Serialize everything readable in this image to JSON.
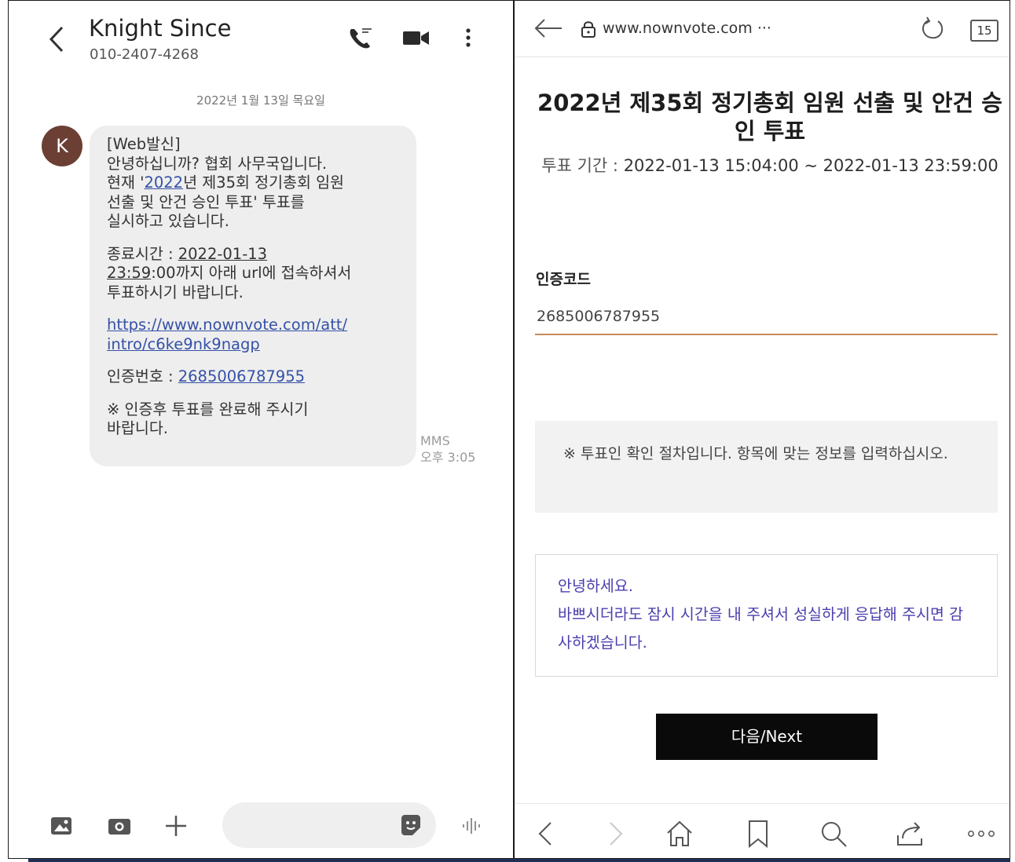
{
  "sms": {
    "contact_name": "Knight Since",
    "contact_number": "010-2407-4268",
    "date_divider": "2022년 1월 13일 목요일",
    "avatar_initial": "K",
    "message": {
      "line1": "[Web발신]",
      "line2": "안녕하십니까? 협회 사무국입니다.",
      "line3_a": "현재 '",
      "line3_b": "2022",
      "line3_c": "년 제35회 정기총회 임원",
      "line4": "선출 및 안건 승인 투표' 투표를",
      "line5": "실시하고 있습니다.",
      "end_label": "종료시간 : ",
      "end_date": "2022-01-13",
      "end_time": "23:59",
      "end_rest": ":00까지 아래 url에 접속하셔서",
      "end_line2": "투표하시기 바랍니다.",
      "link_line1": "https://www.nownvote.com/att/",
      "link_line2": "intro/c6ke9nk9nagp",
      "auth_label": "인증번호 : ",
      "auth_code": "2685006787955",
      "note_line1": "※ 인증후 투표를 완료해 주시기",
      "note_line2": "바랍니다."
    },
    "meta_type": "MMS",
    "meta_time": "오후 3:05"
  },
  "browser": {
    "url": "www.nownvote.com ···",
    "tab_count": "15",
    "title": "2022년 제35회 정기총회 임원 선출 및 안건 승인 투표",
    "period_label": "투표 기간 : ",
    "period_value": "2022-01-13 15:04:00 ~ 2022-01-13 23:59:00",
    "code_label": "인증코드",
    "code_value": "2685006787955",
    "notice": "※ 투표인 확인 절차입니다. 항목에 맞는 정보를 입력하십시오.",
    "greeting_line1": "안녕하세요.",
    "greeting_line2": "바쁘시더라도 잠시 시간을 내 주셔서 성실하게 응답해 주시면 감사하겠습니다.",
    "next_label": "다음/Next"
  }
}
